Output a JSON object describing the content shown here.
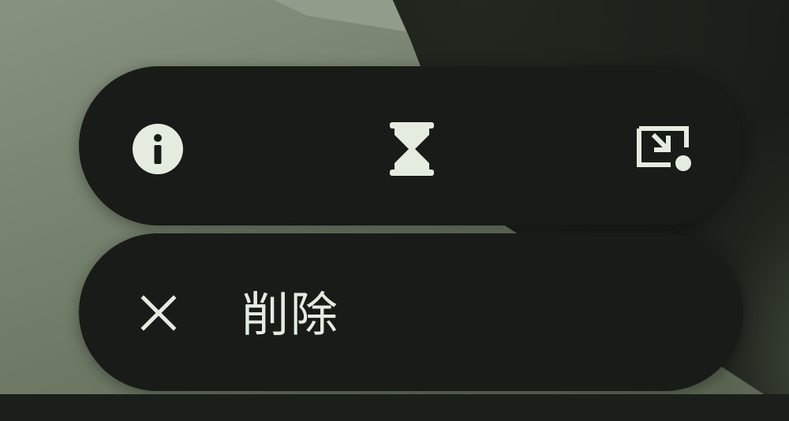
{
  "colors": {
    "pill_background": "#181b17",
    "icon_foreground": "#e4ece0",
    "wallpaper_light": "#8a9584",
    "wallpaper_dark": "#181c17"
  },
  "actions_bar": {
    "buttons": [
      {
        "icon": "info-icon"
      },
      {
        "icon": "hourglass-icon"
      },
      {
        "icon": "picture-in-picture-icon"
      }
    ]
  },
  "delete_bar": {
    "close_icon": "close-icon",
    "label": "削除"
  }
}
